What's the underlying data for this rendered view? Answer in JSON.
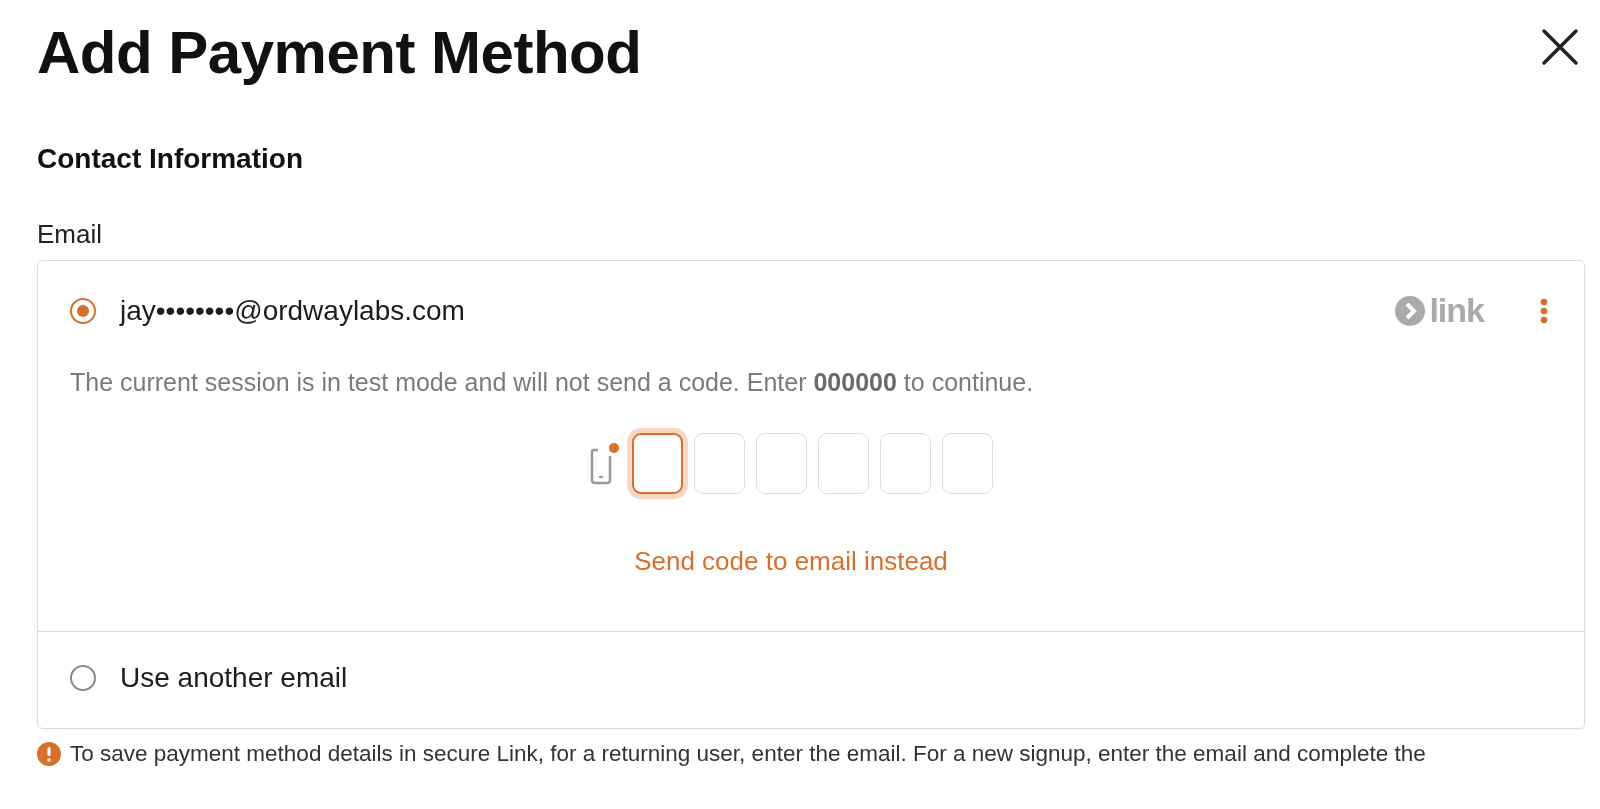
{
  "dialog": {
    "title": "Add Payment Method"
  },
  "section": {
    "title": "Contact Information"
  },
  "email": {
    "label": "Email",
    "options": [
      {
        "kind": "saved",
        "text": "jay••••••••@ordwaylabs.com",
        "selected": true,
        "badge": "link",
        "note": "The current session is in test mode and will not send a code. Enter **000000** to continue.",
        "code_boxes": [
          {
            "selected": true
          },
          {
            "selected": false
          },
          {
            "selected": false
          },
          {
            "selected": false
          },
          {
            "selected": false
          },
          {
            "selected": false
          }
        ],
        "resend_link": "Send code to email instead"
      },
      {
        "kind": "other",
        "text": "Use another email",
        "selected": false
      }
    ]
  },
  "footer_note": "To save payment method details in secure Link, for a returning user, enter the email. For a new signup, enter the email and complete the"
}
